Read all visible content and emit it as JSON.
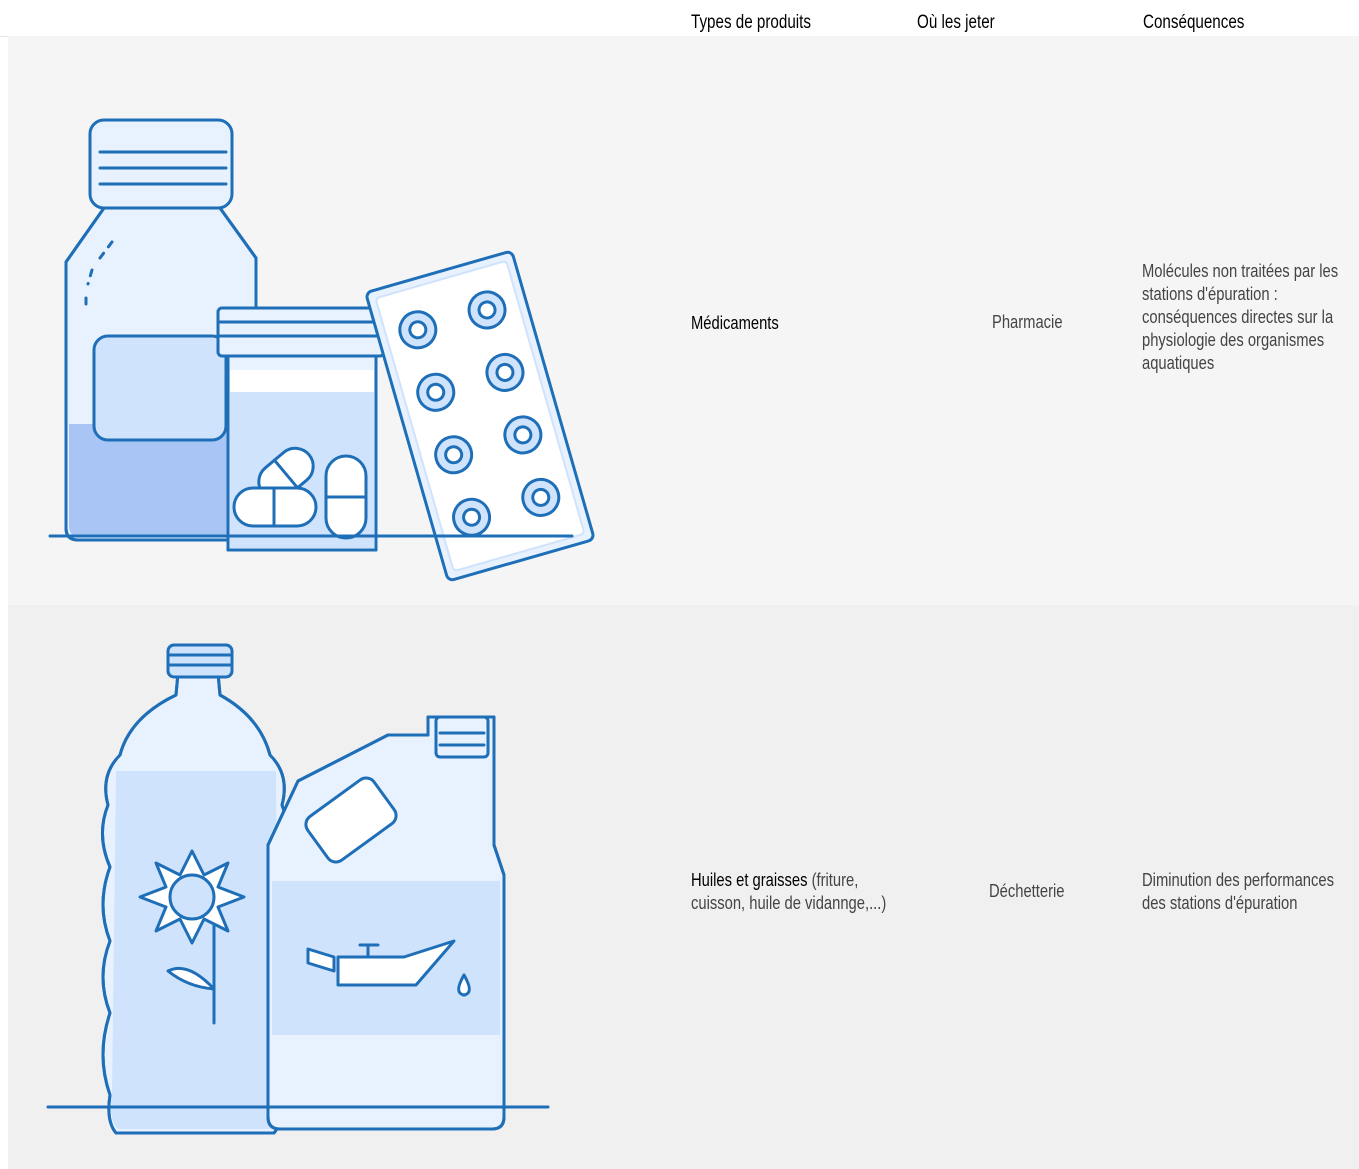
{
  "header": {
    "col_type": "Types de produits",
    "col_where": "Où les jeter",
    "col_consequences": "Conséquences"
  },
  "rows": [
    {
      "illustration_icon": "medicine-bottles-icon",
      "type_name": "Médicaments",
      "type_detail": "",
      "where": "Pharmacie",
      "consequences": "Molécules non traitées par les stations d'épuration : conséquences directes sur la physiologie des organismes aquatiques"
    },
    {
      "illustration_icon": "oil-bottles-icon",
      "type_name": "Huiles et graisses",
      "type_detail": " (friture, cuisson, huile de vidannge,...)",
      "where": "Déchetterie",
      "consequences": "Diminution des performances des stations d'épuration"
    }
  ],
  "colors": {
    "stroke": "#1e6fb8",
    "fill_light": "#e8f2fe",
    "fill_mid": "#cfe3fc",
    "fill_dark": "#a9c5f5"
  }
}
